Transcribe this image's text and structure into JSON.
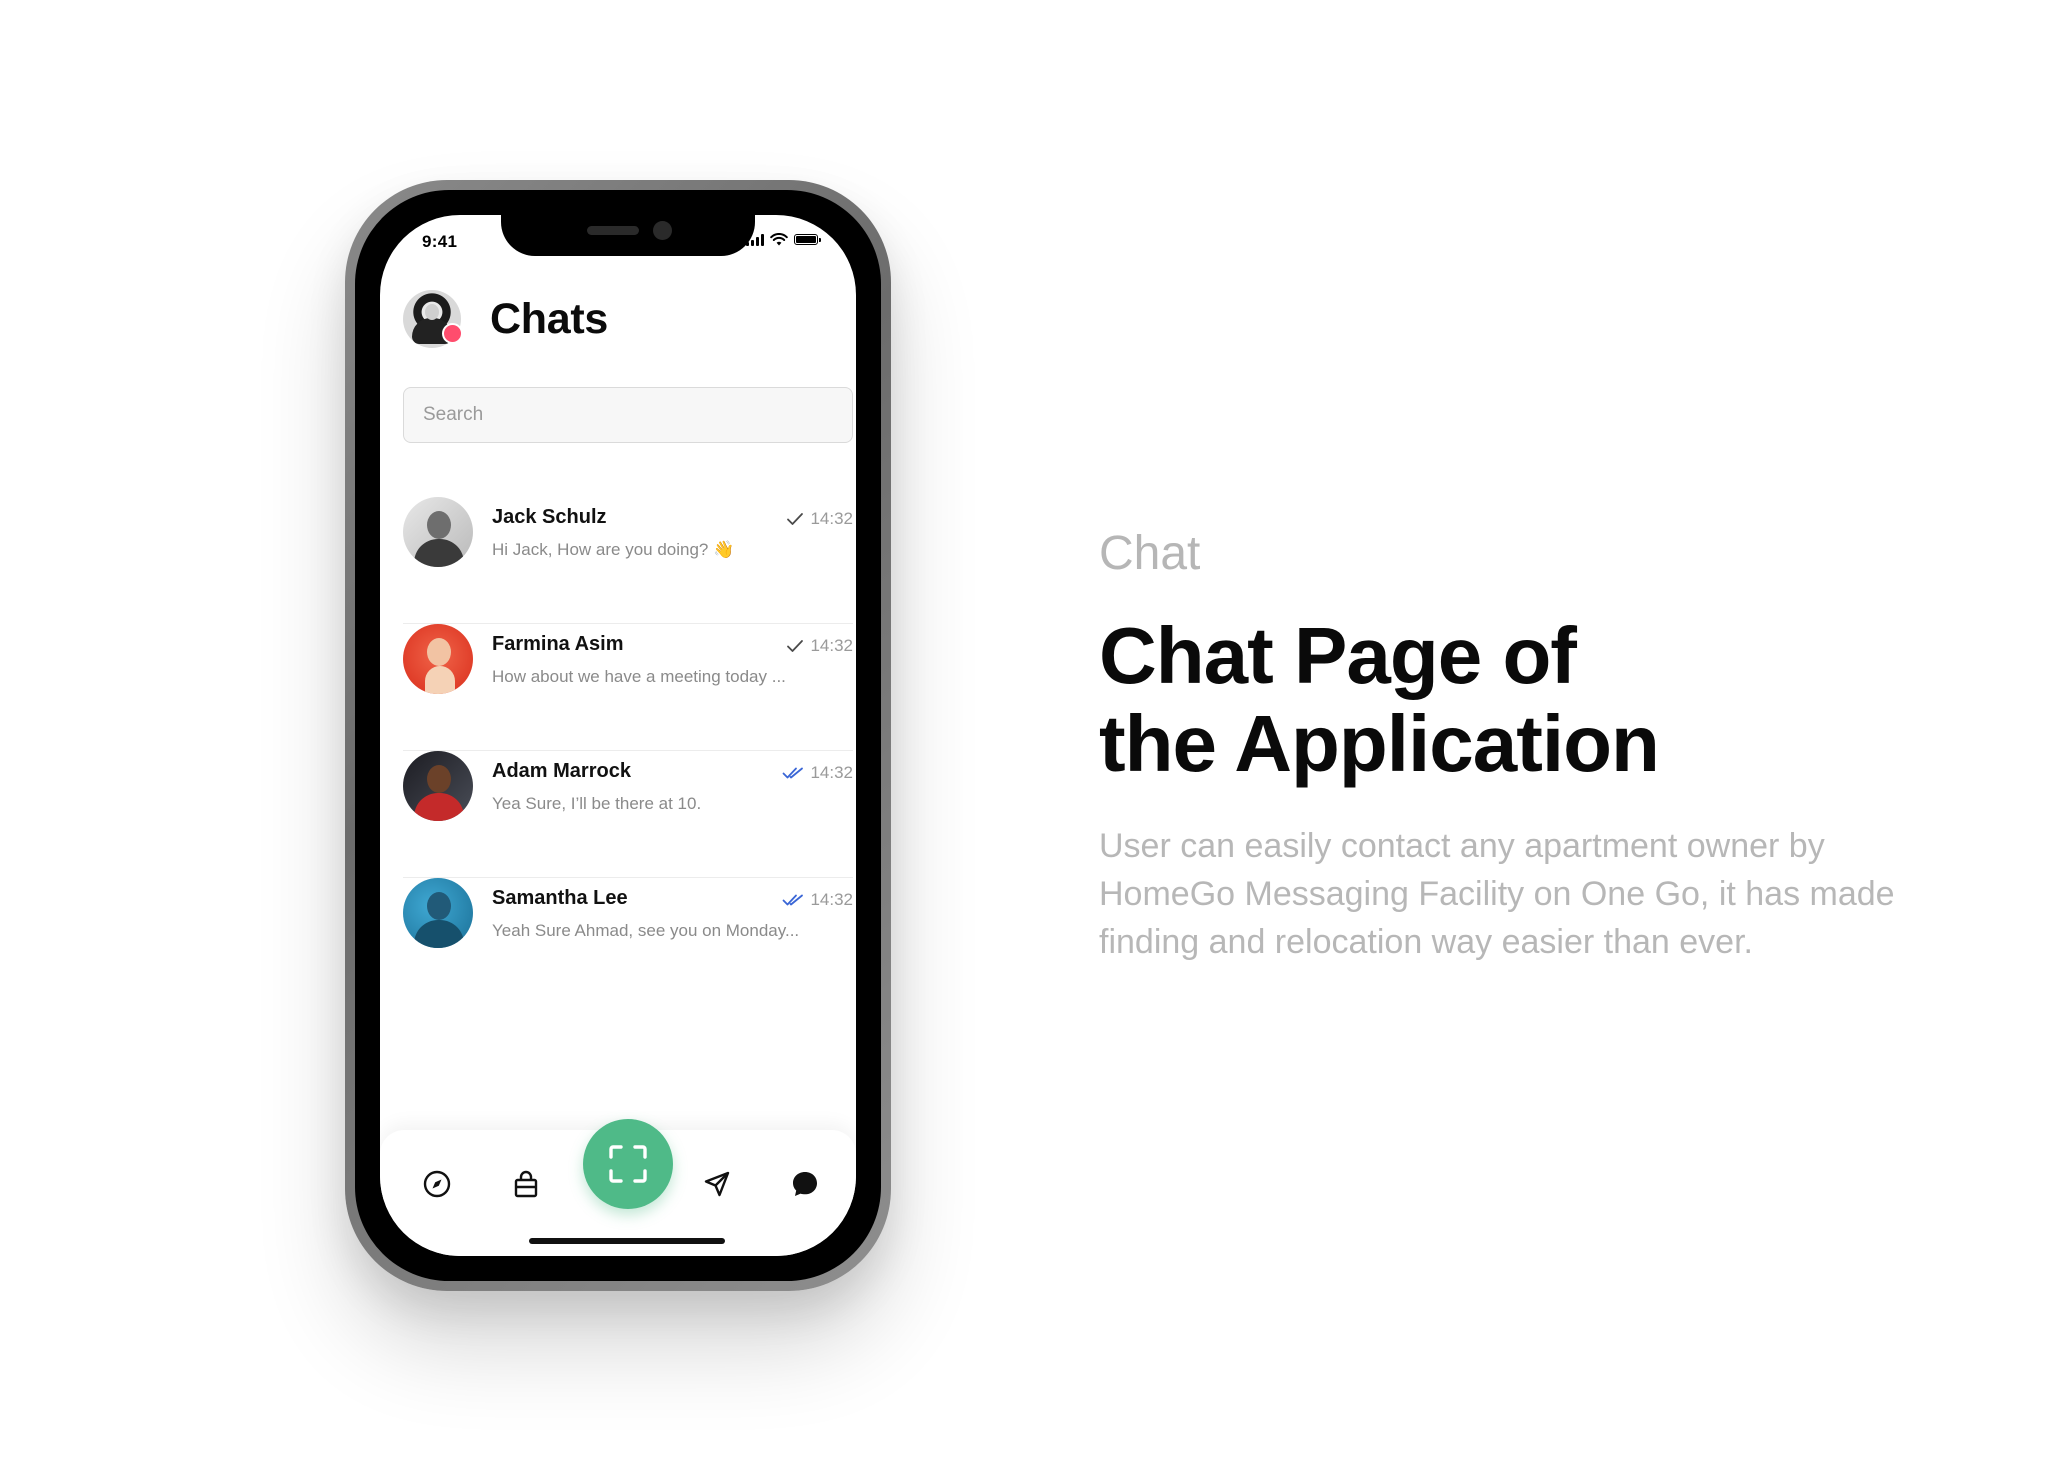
{
  "status_bar": {
    "time": "9:41"
  },
  "app": {
    "title": "Chats",
    "search_placeholder": "Search"
  },
  "colors": {
    "accent_green": "#4fba88",
    "online_dot": "#ff4d6d",
    "read_check_blue": "#3a66d6"
  },
  "chats": [
    {
      "name": "Jack Schulz",
      "preview": "Hi Jack, How are you doing? 👋",
      "time": "14:32",
      "status_icon": "single-check-icon"
    },
    {
      "name": "Farmina Asim",
      "preview": "How about we have a meeting today ...",
      "time": "14:32",
      "status_icon": "single-check-icon"
    },
    {
      "name": "Adam Marrock",
      "preview": "Yea Sure, I’ll be there at 10.",
      "time": "14:32",
      "status_icon": "double-check-icon"
    },
    {
      "name": "Samantha Lee",
      "preview": "Yeah Sure Ahmad, see you on Monday...",
      "time": "14:32",
      "status_icon": "double-check-icon"
    }
  ],
  "bottom_nav": {
    "items": [
      "compass-icon",
      "shopping-bag-icon",
      "scan-icon",
      "send-icon",
      "chat-bubble-icon"
    ],
    "active": "chat-bubble-icon"
  },
  "presentation": {
    "label": "Chat",
    "headline_line1": "Chat Page of",
    "headline_line2": "the Application",
    "description": "User can easily contact any apartment owner by HomeGo Messaging Facility on One Go, it has made finding and relocation way easier than ever."
  }
}
